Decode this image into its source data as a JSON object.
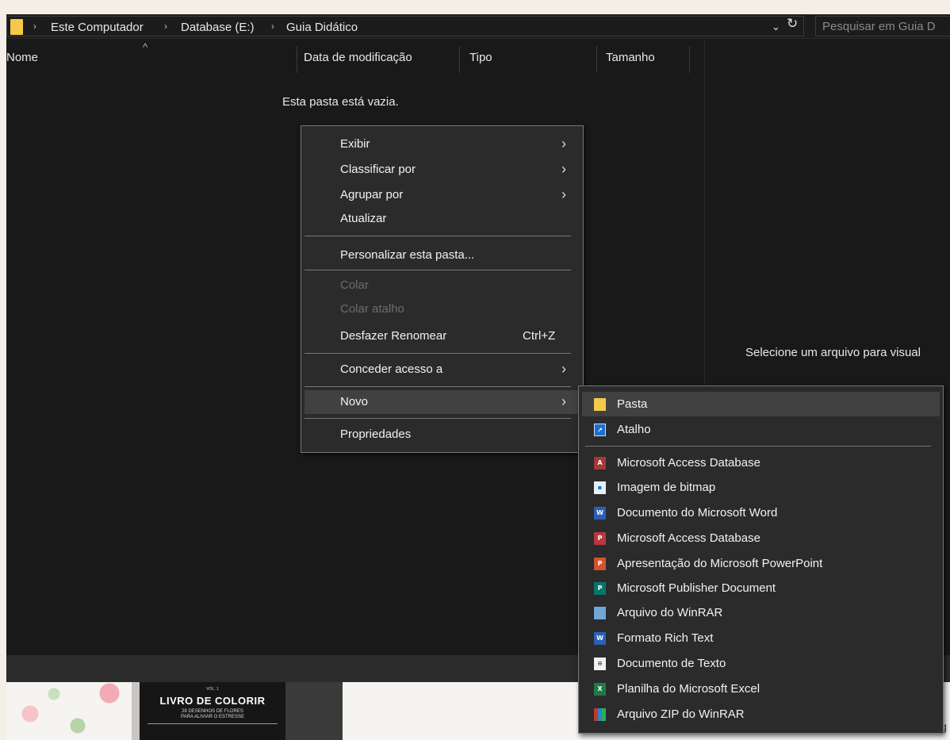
{
  "address": {
    "crumbs": [
      "Este Computador",
      "Database (E:)",
      "Guia Didático"
    ],
    "search_placeholder": "Pesquisar em Guia D"
  },
  "columns": {
    "name": "Nome",
    "modified": "Data de modificação",
    "type": "Tipo",
    "size": "Tamanho"
  },
  "empty_text": "Esta pasta está vazia.",
  "preview_text": "Selecione um arquivo para visual",
  "context_menu": {
    "items": [
      {
        "label": "Exibir",
        "submenu": true
      },
      {
        "label": "Classificar por",
        "submenu": true
      },
      {
        "label": "Agrupar por",
        "submenu": true
      },
      {
        "label": "Atualizar"
      },
      {
        "label": "Personalizar esta pasta..."
      },
      {
        "label": "Colar",
        "disabled": true
      },
      {
        "label": "Colar atalho",
        "disabled": true
      },
      {
        "label": "Desfazer Renomear",
        "shortcut": "Ctrl+Z"
      },
      {
        "label": "Conceder acesso a",
        "submenu": true
      },
      {
        "label": "Novo",
        "submenu": true,
        "highlighted": true
      },
      {
        "label": "Propriedades"
      }
    ]
  },
  "new_submenu": {
    "items": [
      {
        "label": "Pasta",
        "icon": "folder-icon",
        "highlighted": true
      },
      {
        "label": "Atalho",
        "icon": "shortcut-icon"
      },
      {
        "label": "Microsoft Access Database",
        "icon": "access-icon"
      },
      {
        "label": "Imagem de bitmap",
        "icon": "bitmap-icon"
      },
      {
        "label": "Documento do Microsoft Word",
        "icon": "word-icon"
      },
      {
        "label": "Microsoft Access Database",
        "icon": "access-icon"
      },
      {
        "label": "Apresentação do Microsoft PowerPoint",
        "icon": "powerpoint-icon"
      },
      {
        "label": "Microsoft Publisher Document",
        "icon": "publisher-icon"
      },
      {
        "label": "Arquivo do WinRAR",
        "icon": "winrar-icon"
      },
      {
        "label": "Formato Rich Text",
        "icon": "rtf-icon"
      },
      {
        "label": "Documento de Texto",
        "icon": "text-document-icon"
      },
      {
        "label": "Planilha do Microsoft Excel",
        "icon": "excel-icon"
      },
      {
        "label": "Arquivo ZIP do WinRAR",
        "icon": "winrar-zip-icon"
      }
    ]
  },
  "background": {
    "book_vol": "VOL. 1",
    "book_title": "LIVRO DE COLORIR",
    "book_subtitle_1": "28 DESENHOS DE FLORES",
    "book_subtitle_2": "PARA ALIVIAR O ESTRESSE",
    "partial_text": "ig"
  },
  "colors": {
    "window_bg": "#191919",
    "menu_bg": "#2b2b2b",
    "menu_highlight": "#414141",
    "folder_yellow": "#f5c84c"
  }
}
